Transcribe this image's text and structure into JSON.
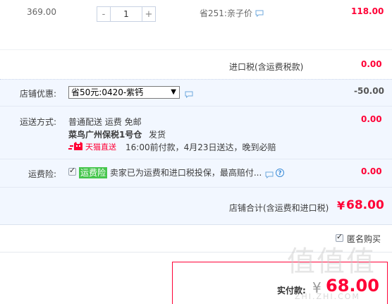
{
  "item": {
    "unit_price": "369.00",
    "quantity": "1",
    "minus": "-",
    "plus": "+",
    "saving": "省251:亲子价",
    "subtotal": "118.00"
  },
  "import_tax": {
    "label": "进口税(含运费税款)",
    "value": "0.00"
  },
  "shop_discount": {
    "label": "店铺优惠:",
    "selected": "省50元:0420-紫钙",
    "value": "-50.00"
  },
  "shipping": {
    "label": "运送方式:",
    "method": "普通配送 运费 免邮",
    "warehouse": "菜鸟广州保税1号仓",
    "dispatch": "发货",
    "tmall_badge": "天猫直送",
    "delivery_note": "16:00前付款，4月23日送达，晚到必赔",
    "value": "0.00"
  },
  "insurance": {
    "label": "运费险:",
    "tag": "运费险",
    "text": "卖家已为运费和进口税投保，最高赔付...",
    "value": "0.00"
  },
  "shop_total": {
    "label": "店铺合计(含运费和进口税)",
    "currency": "¥",
    "value": "68.00"
  },
  "anonymous": {
    "label": "匿名购买"
  },
  "payment": {
    "label": "实付款:",
    "currency": "¥",
    "value": "68.00"
  },
  "watermark": "值值值",
  "watermark_url": "ZHI.ZHI.COM"
}
